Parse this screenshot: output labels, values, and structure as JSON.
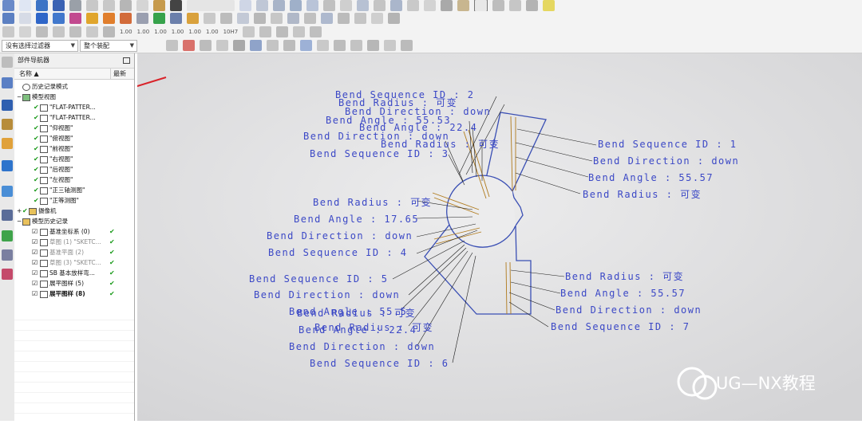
{
  "filter_bar": {
    "selection_filter": "没有选择过滤器",
    "assembly_scope": "整个装配"
  },
  "toolbar_texts": [
    "1.00",
    "1.00",
    "1.00",
    "1.00",
    "1.00",
    "1.00",
    "10H7"
  ],
  "navigator": {
    "title": "部件导航器",
    "col_name": "名称",
    "col_latest": "最新",
    "items": [
      {
        "label": "历史记录模式"
      },
      {
        "label": "模型视图"
      },
      {
        "label": "\"FLAT-PATTER..."
      },
      {
        "label": "\"FLAT-PATTER..."
      },
      {
        "label": "\"仰视图\""
      },
      {
        "label": "\"俯视图\""
      },
      {
        "label": "\"前视图\""
      },
      {
        "label": "\"右视图\""
      },
      {
        "label": "\"后视图\""
      },
      {
        "label": "\"左视图\""
      },
      {
        "label": "\"正三轴测图\""
      },
      {
        "label": "\"正等测图\""
      },
      {
        "label": "摄像机"
      },
      {
        "label": "模型历史记录"
      },
      {
        "label": "基准坐标系 (0)"
      },
      {
        "label": "草图 (1) \"SKETC..."
      },
      {
        "label": "基准平面 (2)"
      },
      {
        "label": "草图 (3) \"SKETC..."
      },
      {
        "label": "SB 基本放样弯..."
      },
      {
        "label": "展平图样 (5)"
      },
      {
        "label": "展平图样 (8)"
      }
    ]
  },
  "annotations": [
    {
      "label": "Bend Sequence ID : 2"
    },
    {
      "label": "Bend Radius : 可变"
    },
    {
      "label": "Bend Direction : down"
    },
    {
      "label": "Bend Angle : 55.53"
    },
    {
      "label": "Bend Angle : 22.4"
    },
    {
      "label": "Bend Direction : down"
    },
    {
      "label": "Bend Radius : 可变"
    },
    {
      "label": "Bend Sequence ID : 3"
    },
    {
      "label": "Bend Sequence ID : 1"
    },
    {
      "label": "Bend Direction : down"
    },
    {
      "label": "Bend Angle : 55.57"
    },
    {
      "label": "Bend Radius : 可变"
    },
    {
      "label": "Bend Radius : 可变"
    },
    {
      "label": "Bend Angle : 17.65"
    },
    {
      "label": "Bend Direction : down"
    },
    {
      "label": "Bend Sequence ID : 4"
    },
    {
      "label": "Bend Sequence ID : 5"
    },
    {
      "label": "Bend Direction : down"
    },
    {
      "label": "Bend Angle : 55.5"
    },
    {
      "label": "Bend Radius : 可变"
    },
    {
      "label": "Bend Angle : 22.4"
    },
    {
      "label": "Bend Radius : 可变"
    },
    {
      "label": "Bend Direction : down"
    },
    {
      "label": "Bend Sequence ID : 6"
    },
    {
      "label": "Bend Radius : 可变"
    },
    {
      "label": "Bend Angle : 55.57"
    },
    {
      "label": "Bend Direction : down"
    },
    {
      "label": "Bend Sequence ID : 7"
    }
  ],
  "watermark": "UG—NX教程",
  "colors": {
    "viewport_bg": "#d9d9da",
    "annotation": "#3b48c6",
    "part_edge": "#3a4fb4",
    "bend_line": "#b07a1c",
    "accent_red": "#d9232a",
    "check_green": "#1a9a1a"
  }
}
